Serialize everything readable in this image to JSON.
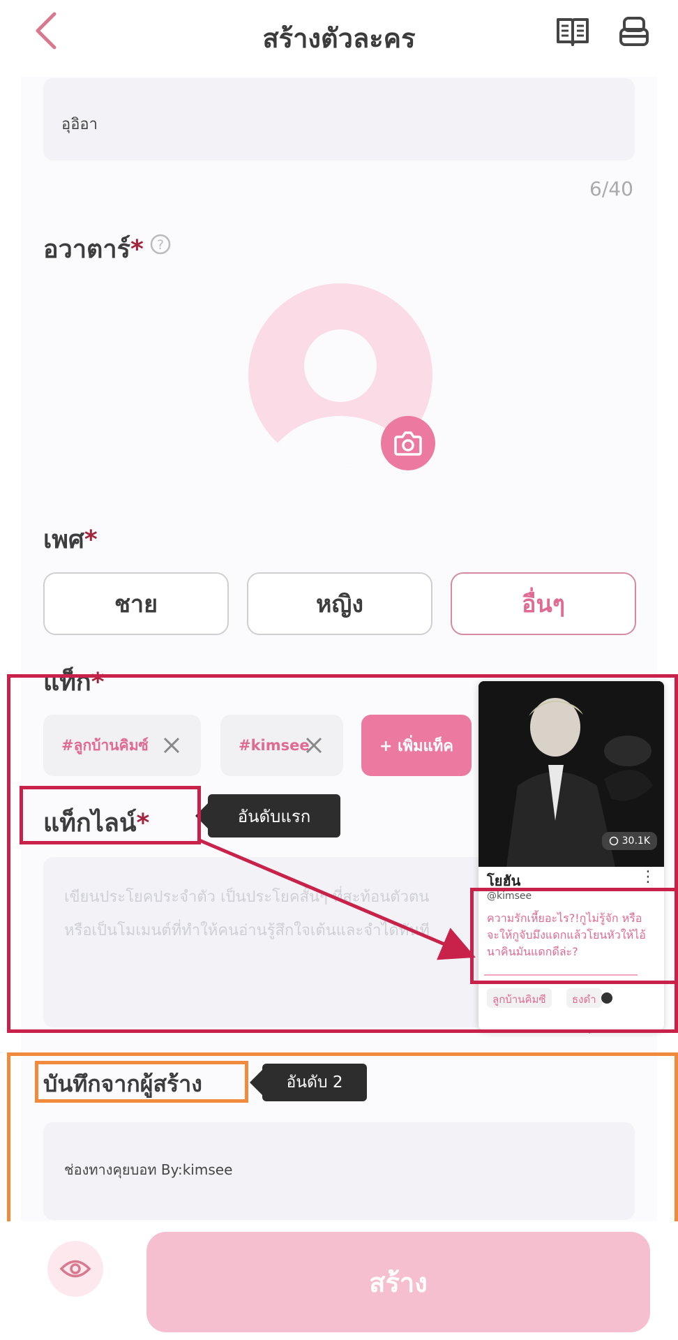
{
  "header": {
    "title": "สร้างตัวละคร"
  },
  "name": {
    "value": "อุอิอา",
    "counter": "6/40"
  },
  "avatar": {
    "label": "อวาตาร์",
    "required": "*"
  },
  "gender": {
    "label": "เพศ",
    "required": "*",
    "options": [
      "ชาย",
      "หญิง",
      "อื่นๆ"
    ],
    "selected": "อื่นๆ"
  },
  "tags": {
    "label": "แท็ก",
    "required": "*",
    "items": [
      "#ลูกบ้านคิมซ์",
      "#kimsee"
    ],
    "add_label": "+  เพิ่มแท็ค"
  },
  "tagline": {
    "label": "แท็กไลน์",
    "required": "*",
    "placeholder_line1": "เขียนประโยคประจำตัว  เป็นประโยคสั้นๆ  ที่สะท้อนตัวตน",
    "placeholder_line2": "หรือเป็นโมเมนต์ที่ทำให้คนอ่านรู้สึกใจเต้นและจำได้ทันที",
    "counter": "0/100",
    "callout": "อันดับแรก"
  },
  "preview_card": {
    "count": "30.1K",
    "name": "โยฮัน",
    "handle": "@kimsee",
    "tagline": "ความรักเหี้ยอะไร?!กูไม่รู้จัก หรือจะให้กูจับมึงแดกแล้วโยนหัวให้ไอ้นาคินมันแดกดีล่ะ?",
    "tags": [
      "ลูกบ้านคิมซี",
      "ธงดำ"
    ]
  },
  "creator_note": {
    "label": "บันทึกจากผู้สร้าง",
    "callout": "อันดับ 2",
    "value": "ช่องทางคุยบอท   By:kimsee"
  },
  "footer": {
    "create_label": "สร้าง"
  },
  "colors": {
    "accent": "#ec7aa0",
    "annotation_red": "#c8224a",
    "annotation_orange": "#f08a3c"
  }
}
